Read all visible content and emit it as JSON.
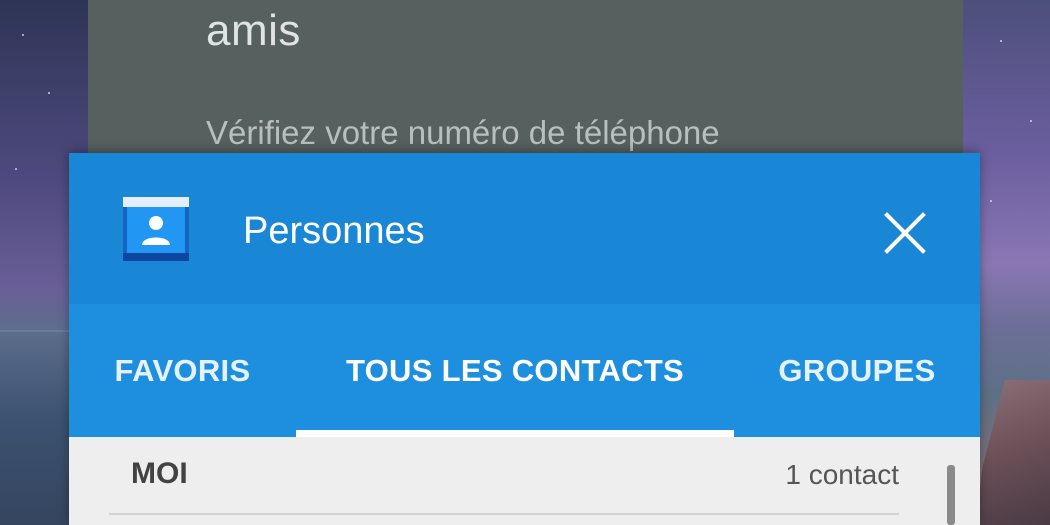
{
  "background_card": {
    "title": "amis",
    "subtitle": "Vérifiez votre numéro de téléphone"
  },
  "app": {
    "title": "Personnes",
    "icon": "contacts-app-icon",
    "close_icon": "close-icon",
    "accent_color": "#1a87d6"
  },
  "tabs": [
    {
      "label": "FAVORIS",
      "selected": false
    },
    {
      "label": "TOUS LES CONTACTS",
      "selected": true
    },
    {
      "label": "GROUPES",
      "selected": false
    }
  ],
  "list": {
    "section_title": "MOI",
    "section_count": "1 contact"
  }
}
